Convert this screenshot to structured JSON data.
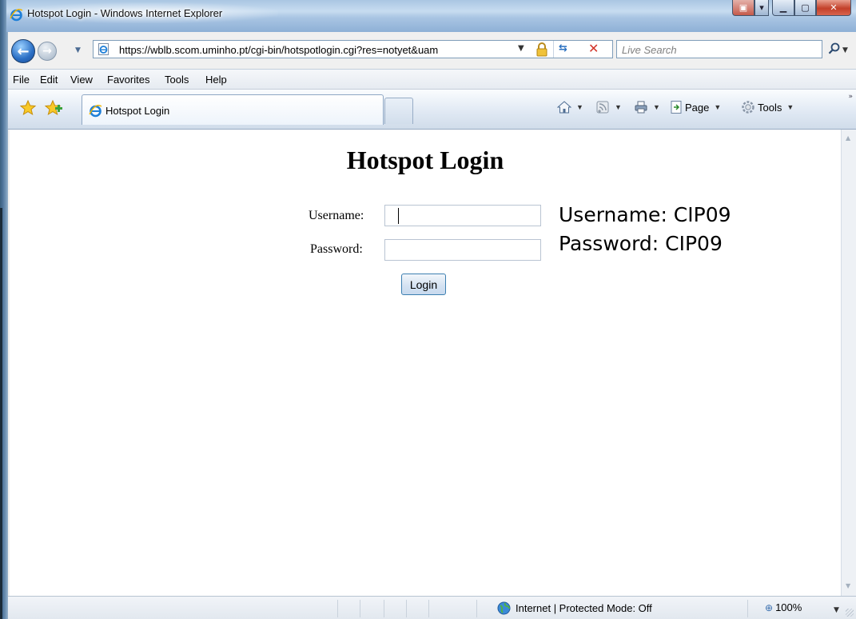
{
  "window": {
    "title": "Hotspot Login - Windows Internet Explorer"
  },
  "address": {
    "url": "https://wblb.scom.uminho.pt/cgi-bin/hotspotlogin.cgi?res=notyet&uam"
  },
  "search": {
    "placeholder": "Live Search"
  },
  "menu": {
    "items": [
      "File",
      "Edit",
      "View",
      "Favorites",
      "Tools",
      "Help"
    ]
  },
  "tabs": {
    "active_label": "Hotspot Login"
  },
  "command_bar": {
    "page_label": "Page",
    "tools_label": "Tools"
  },
  "content": {
    "title": "Hotspot Login",
    "username_label": "Username:",
    "password_label": "Password:",
    "username_value": "",
    "password_value": "",
    "login_label": "Login",
    "note_username": "Username: CIP09",
    "note_password": "Password: CIP09"
  },
  "status": {
    "zone": "Internet | Protected Mode: Off",
    "zoom": "100%"
  },
  "colors": {
    "titlebar": "#a9c5e3",
    "button_border": "#3c7fb1",
    "close_button": "#c3402a"
  }
}
